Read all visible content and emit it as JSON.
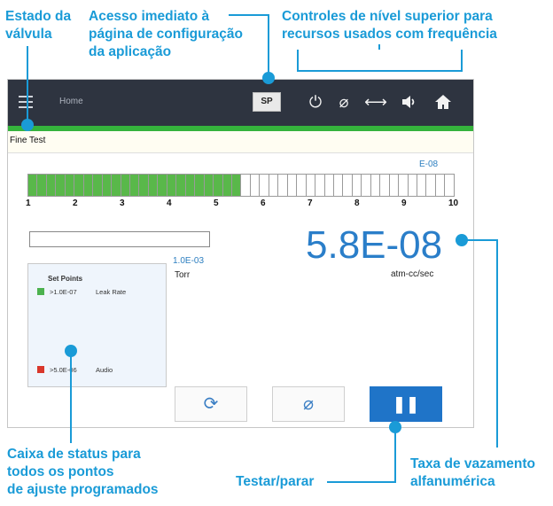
{
  "annotations": {
    "valve_state": [
      "Estado da",
      "válvula"
    ],
    "config_access": [
      "Acesso imediato à",
      "página de configuração",
      "da aplicação"
    ],
    "top_controls": [
      "Controles de nível superior para",
      "recursos usados com frequência"
    ],
    "status_box": [
      "Caixa de status para",
      "todos os pontos",
      "de ajuste programados"
    ],
    "test_stop": "Testar/parar",
    "leak_rate": [
      "Taxa de vazamento",
      "alfanumérica"
    ]
  },
  "topbar": {
    "home_label": "Home",
    "sp_label": "SP",
    "icons": [
      "power-icon",
      "zero-icon",
      "arrows-icon",
      "speaker-icon",
      "home-icon"
    ]
  },
  "tab": {
    "label": "Fine Test"
  },
  "bar_graph": {
    "marker_label": "E-08",
    "filled_fraction": 0.5,
    "scale": [
      "1",
      "2",
      "3",
      "4",
      "5",
      "6",
      "7",
      "8",
      "9",
      "10"
    ]
  },
  "pressure": {
    "threshold": "1.0E-03",
    "unit": "Torr"
  },
  "leak": {
    "value": "5.8E-08",
    "unit": "atm-cc/sec"
  },
  "setpoints": {
    "title": "Set Points",
    "items": [
      {
        "value": ">1.0E-07",
        "label": "Leak Rate",
        "color": "#4cb24f"
      },
      {
        "value": ">5.0E-06",
        "label": "Audio",
        "color": "#d9372b"
      }
    ]
  },
  "buttons": {
    "restart_icon": "⟳",
    "zero_icon": "⌀",
    "pause_icon": "❚❚"
  },
  "colors": {
    "accent": "#1a9bd7",
    "green": "#35b33c",
    "topbar": "#2e3440"
  }
}
